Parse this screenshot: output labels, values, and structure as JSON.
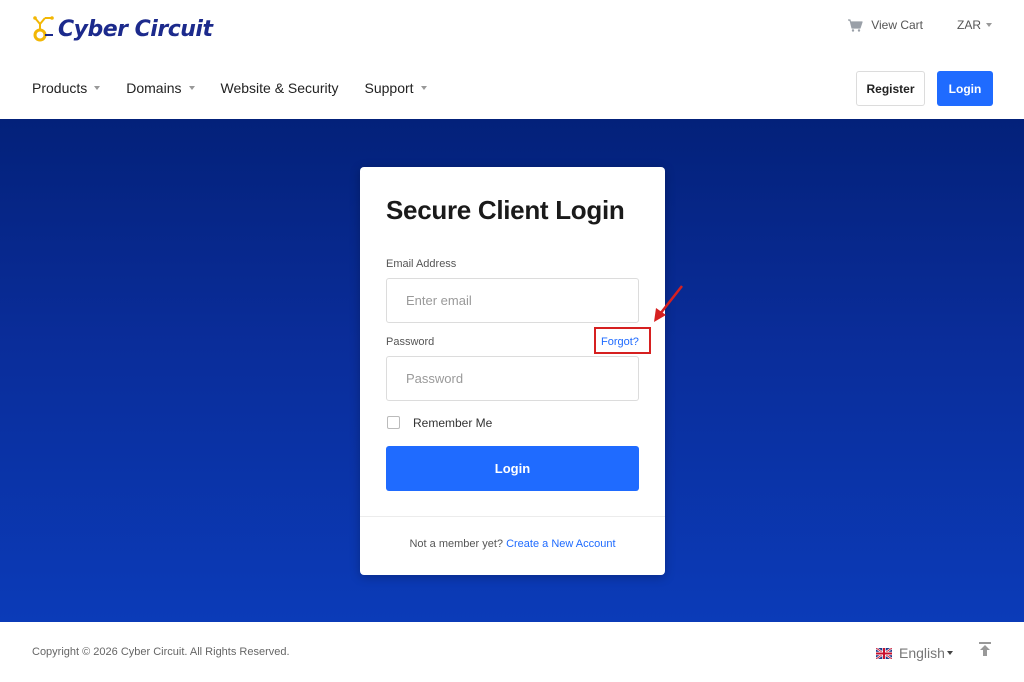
{
  "header": {
    "logo_text": "Cyber Circuit",
    "cart_label": "View Cart",
    "currency": "ZAR",
    "nav": [
      {
        "label": "Products"
      },
      {
        "label": "Domains"
      },
      {
        "label": "Website & Security"
      },
      {
        "label": "Support"
      }
    ],
    "register_label": "Register",
    "login_label": "Login"
  },
  "login_card": {
    "title": "Secure Client Login",
    "email_label": "Email Address",
    "email_placeholder": "Enter email",
    "password_label": "Password",
    "password_placeholder": "Password",
    "forgot_label": "Forgot?",
    "remember_label": "Remember Me",
    "submit_label": "Login",
    "footer_prefix": "Not a member yet?",
    "footer_link": "Create a New Account"
  },
  "footer": {
    "copyright": "Copyright © 2026 Cyber Circuit. All Rights Reserved.",
    "language": "English"
  },
  "colors": {
    "accent": "#1f6bff",
    "hero_top": "#03217a",
    "hero_bottom": "#0b3bb8",
    "highlight": "#d62020"
  }
}
